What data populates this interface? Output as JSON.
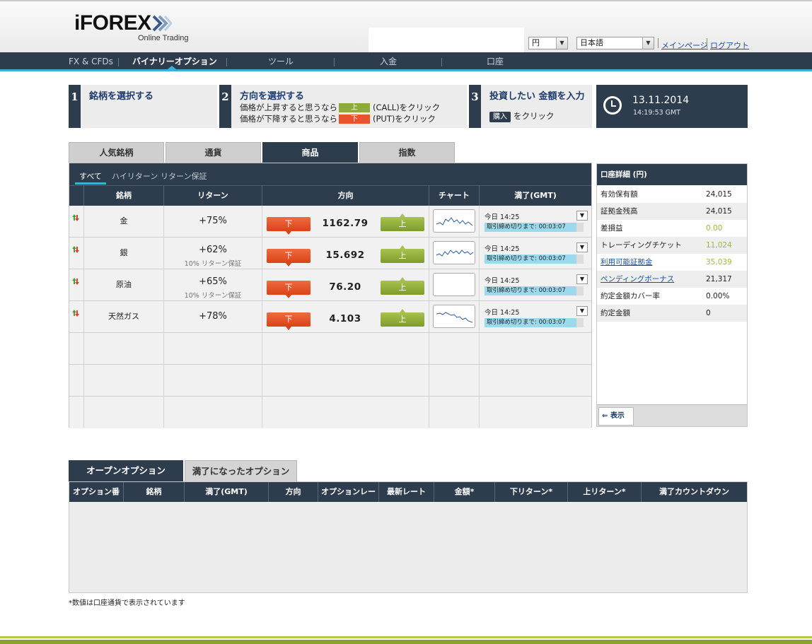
{
  "header": {
    "logo_text": "iFOREX",
    "logo_sub": "Online Trading",
    "currency": "円",
    "language": "日本語",
    "link_main": "メインページ",
    "link_logout": "ログアウト"
  },
  "nav": {
    "items": [
      "FX & CFDs",
      "バイナリーオプション",
      "ツール",
      "入金",
      "口座"
    ],
    "active_index": 1
  },
  "steps": {
    "s1": {
      "num": "1",
      "title": "銘柄を選択する"
    },
    "s2": {
      "num": "2",
      "title": "方向を選択する",
      "line1_pre": "価格が上昇すると思うなら",
      "line1_btn": "上",
      "line1_post": "(CALL)をクリック",
      "line2_pre": "価格が下降すると思うなら",
      "line2_btn": "下",
      "line2_post": "(PUT)をクリック"
    },
    "s3": {
      "num": "3",
      "title": "投資したい 金額を入力",
      "buy_chip": "購入",
      "post": "をクリック"
    }
  },
  "clock": {
    "date": "13.11.2014",
    "time": "14:19:53 GMT"
  },
  "categories": [
    "人気銘柄",
    "通貨",
    "商品",
    "指数"
  ],
  "subtabs": [
    "すべて",
    "ハイリターン",
    "リターン保証"
  ],
  "market_headers": [
    "銘柄",
    "リターン",
    "方向",
    "チャート",
    "満了(GMT)"
  ],
  "assets": [
    {
      "name": "金",
      "ret": "+75%",
      "ret_sub": "",
      "price": "1162.79",
      "down": "下",
      "up": "上",
      "expiry": "今日 14:25",
      "countdown": "取引締め切りまで: 00:03:07"
    },
    {
      "name": "銀",
      "ret": "+62%",
      "ret_sub": "10% リターン保証",
      "price": "15.692",
      "down": "下",
      "up": "上",
      "expiry": "今日 14:25",
      "countdown": "取引締め切りまで: 00:03:07"
    },
    {
      "name": "原油",
      "ret": "+65%",
      "ret_sub": "10% リターン保証",
      "price": "76.20",
      "down": "下",
      "up": "上",
      "expiry": "今日 14:25",
      "countdown": "取引締め切りまで: 00:03:07"
    },
    {
      "name": "天然ガス",
      "ret": "+78%",
      "ret_sub": "",
      "price": "4.103",
      "down": "下",
      "up": "上",
      "expiry": "今日 14:25",
      "countdown": "取引締め切りまで: 00:03:07"
    }
  ],
  "account": {
    "title": "口座詳細 (円)",
    "rows": [
      {
        "label": "有効保有額",
        "value": "24,015"
      },
      {
        "label": "証拠金残高",
        "value": "24,015"
      },
      {
        "label": "差損益",
        "value": "0.00"
      },
      {
        "label": "トレーディングチケット",
        "value": "11,024"
      },
      {
        "label": "利用可能証拠金",
        "value": "35,039"
      },
      {
        "label": "ペンディングボーナス",
        "value": "21,317"
      },
      {
        "label": "約定金額カバー率",
        "value": "0.00%"
      },
      {
        "label": "約定金額",
        "value": "0"
      }
    ],
    "show_button": "表示"
  },
  "options": {
    "tab_open": "オープンオプション",
    "tab_expired": "満了になったオプション",
    "headers": [
      "オプション番",
      "銘柄",
      "満了(GMT)",
      "方向",
      "オプションレー",
      "最新レート",
      "金額*",
      "下リターン*",
      "上リターン*",
      "満了カウントダウン"
    ]
  },
  "footnote": "*数値は口座通貨で表示されています",
  "colors": {
    "navy": "#2e3d4d",
    "accent": "#3fb0d4",
    "call": "#8eab3a",
    "put": "#e8532c"
  }
}
